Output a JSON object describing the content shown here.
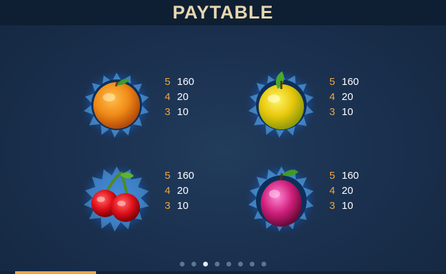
{
  "header": {
    "title": "PAYTABLE"
  },
  "symbols": [
    {
      "name": "orange-icon",
      "pays": [
        {
          "count": "5",
          "value": "160"
        },
        {
          "count": "4",
          "value": "20"
        },
        {
          "count": "3",
          "value": "10"
        }
      ]
    },
    {
      "name": "lemon-icon",
      "pays": [
        {
          "count": "5",
          "value": "160"
        },
        {
          "count": "4",
          "value": "20"
        },
        {
          "count": "3",
          "value": "10"
        }
      ]
    },
    {
      "name": "cherries-icon",
      "pays": [
        {
          "count": "5",
          "value": "160"
        },
        {
          "count": "4",
          "value": "20"
        },
        {
          "count": "3",
          "value": "10"
        }
      ]
    },
    {
      "name": "plum-icon",
      "pays": [
        {
          "count": "5",
          "value": "160"
        },
        {
          "count": "4",
          "value": "20"
        },
        {
          "count": "3",
          "value": "10"
        }
      ]
    }
  ],
  "pagination": {
    "total_pages": 8,
    "current_page": 3
  },
  "colors": {
    "pay_count": "#f0a640",
    "pay_value": "#ffffff",
    "title": "#e7d7b0",
    "accent": "#f0a640"
  }
}
